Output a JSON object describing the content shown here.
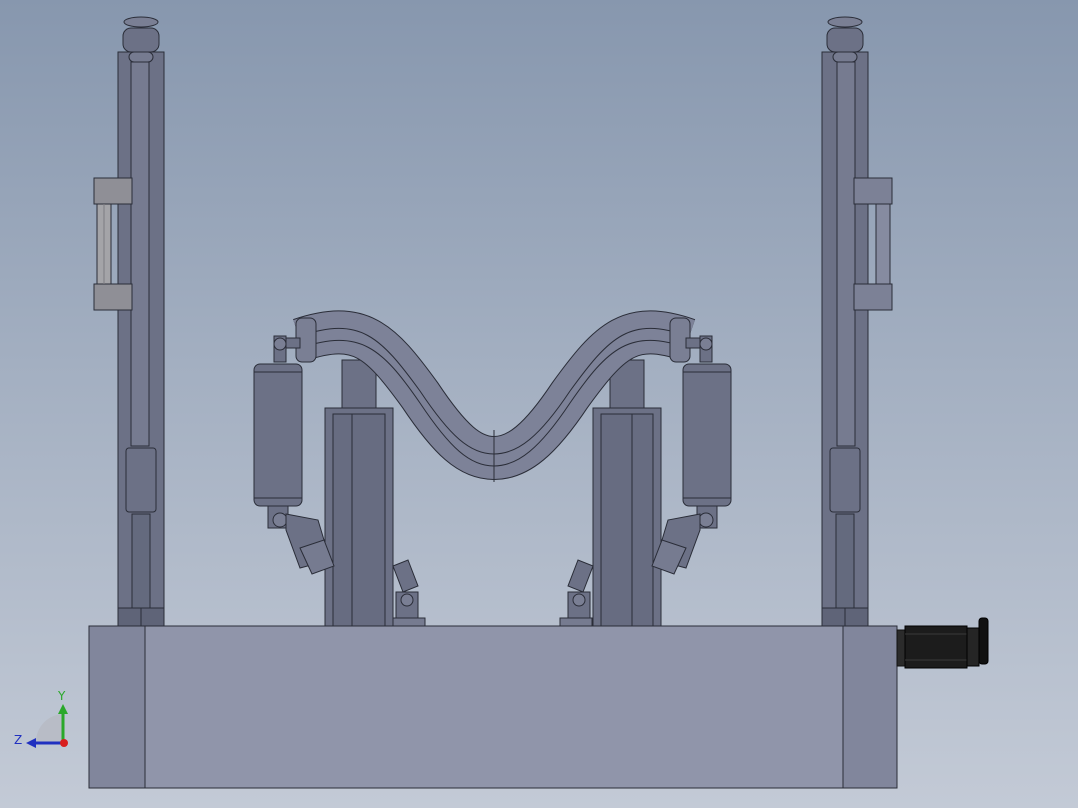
{
  "viewport": {
    "background_top": "#8797ae",
    "background_bottom": "#c3cad6"
  },
  "colors": {
    "part_fill": "#6c7186",
    "part_light": "#858aa0",
    "part_dark": "#5a5f73",
    "edge": "#2a2d38",
    "base_front": "#9095aa",
    "base_side": "#81869c",
    "motor_body": "#1c1c1c",
    "bracket_light": "#9a9a9a"
  },
  "triad": {
    "x_axis_color": "#d81e1e",
    "y_axis_color": "#2aa82a",
    "z_axis_color": "#2030c0",
    "y_label": "Y",
    "z_label": "Z",
    "icon": "view-orientation-triad-icon"
  }
}
